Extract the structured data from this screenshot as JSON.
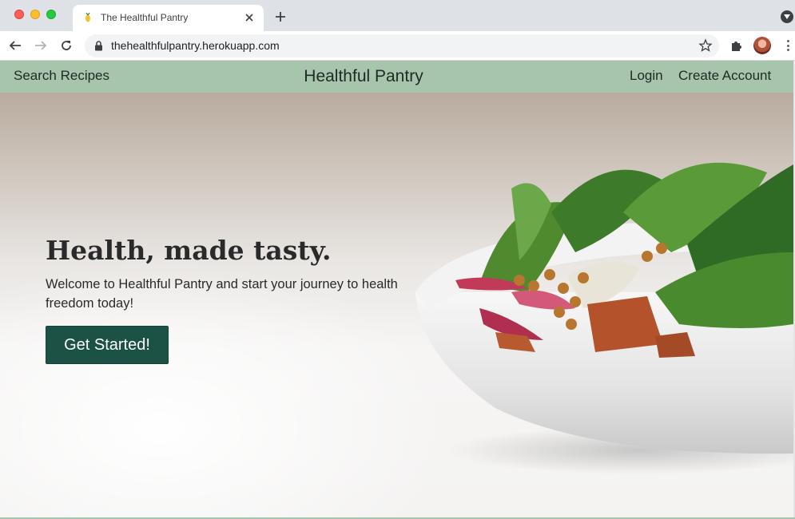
{
  "browser": {
    "tab_title": "The Healthful Pantry",
    "url": "thehealthfulpantry.herokuapp.com"
  },
  "nav": {
    "search_recipes": "Search Recipes",
    "brand": "Healthful Pantry",
    "login": "Login",
    "create_account": "Create Account"
  },
  "hero": {
    "title": "Health, made tasty.",
    "subtitle": "Welcome to Healthful Pantry and start your journey to health freedom today!",
    "cta_label": "Get Started!"
  },
  "colors": {
    "nav_bg": "#a7c4ad",
    "cta_bg": "#1c5245"
  },
  "icons": {
    "back": "back-arrow-icon",
    "forward": "forward-arrow-icon",
    "reload": "reload-icon",
    "lock": "lock-icon",
    "bookmark": "star-icon",
    "extensions": "puzzle-icon",
    "menu": "kebab-menu-icon"
  }
}
